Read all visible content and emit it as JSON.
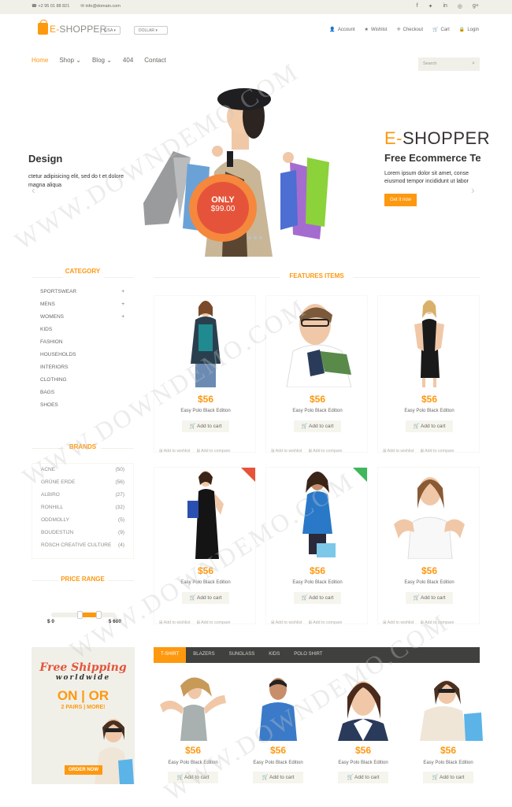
{
  "topbar": {
    "phone": "+2 95 01 88 821",
    "email": "info@domain.com",
    "social_icons": [
      "facebook-icon",
      "twitter-icon",
      "linkedin-icon",
      "dribbble-icon",
      "google-plus-icon"
    ]
  },
  "header": {
    "logo_e": "E-",
    "logo_rest": "SHOPPER",
    "country": "USA",
    "currency": "DOLLAR",
    "account_links": [
      {
        "label": "Account",
        "icon": "user-icon"
      },
      {
        "label": "Wishlist",
        "icon": "star-icon"
      },
      {
        "label": "Checkout",
        "icon": "crosshair-icon"
      },
      {
        "label": "Cart",
        "icon": "cart-icon"
      },
      {
        "label": "Login",
        "icon": "lock-icon"
      }
    ]
  },
  "nav": {
    "items": [
      "Home",
      "Shop",
      "Blog",
      "404",
      "Contact"
    ],
    "search_placeholder": "Search"
  },
  "slider": {
    "left_heading": "Design",
    "left_text": "ctetur adipisicing elit, sed do t et dolore magna aliqua",
    "right_brand_e": "E-",
    "right_brand_rest": "SHOPPER",
    "right_heading": "Free Ecommerce Te",
    "right_text_1": "Lorem ipsum dolor sit amet, conse",
    "right_text_2": "eiusmod tempor incididunt ut labor",
    "button": "Get it now",
    "badge_only": "ONLY",
    "badge_price": "$99.00"
  },
  "sidebar": {
    "category_title": "CATEGORY",
    "categories": [
      {
        "label": "SPORTSWEAR",
        "plus": "+"
      },
      {
        "label": "MENS",
        "plus": "+"
      },
      {
        "label": "WOMENS",
        "plus": "+"
      },
      {
        "label": "KIDS",
        "plus": ""
      },
      {
        "label": "FASHION",
        "plus": ""
      },
      {
        "label": "HOUSEHOLDS",
        "plus": ""
      },
      {
        "label": "INTERIORS",
        "plus": ""
      },
      {
        "label": "CLOTHING",
        "plus": ""
      },
      {
        "label": "BAGS",
        "plus": ""
      },
      {
        "label": "SHOES",
        "plus": ""
      }
    ],
    "brands_title": "BRANDS",
    "brands": [
      {
        "label": "ACNE",
        "count": "(50)"
      },
      {
        "label": "GRÜNE ERDE",
        "count": "(56)"
      },
      {
        "label": "ALBIRO",
        "count": "(27)"
      },
      {
        "label": "RONHILL",
        "count": "(32)"
      },
      {
        "label": "ODDMOLLY",
        "count": "(5)"
      },
      {
        "label": "BOUDESTIJN",
        "count": "(9)"
      },
      {
        "label": "RÖSCH CREATIVE CULTURE",
        "count": "(4)"
      }
    ],
    "price_title": "PRICE RANGE",
    "price_min": "$ 0",
    "price_max": "$ 600",
    "ad": {
      "line1": "Free Shipping",
      "line2": "worldwide",
      "line3": "ON | OR",
      "line4": "2 PAIRS | MORE!",
      "button": "ORDER NOW"
    }
  },
  "features": {
    "title": "FEATURES ITEMS",
    "items": [
      {
        "price": "$56",
        "name": "Easy Polo Black Edition",
        "cart": "Add to cart",
        "ribbon": ""
      },
      {
        "price": "$56",
        "name": "Easy Polo Black Edition",
        "cart": "Add to cart",
        "ribbon": ""
      },
      {
        "price": "$56",
        "name": "Easy Polo Black Edition",
        "cart": "Add to cart",
        "ribbon": ""
      },
      {
        "price": "$56",
        "name": "Easy Polo Black Edition",
        "cart": "Add to cart",
        "ribbon": "new"
      },
      {
        "price": "$56",
        "name": "Easy Polo Black Edition",
        "cart": "Add to cart",
        "ribbon": "sale"
      },
      {
        "price": "$56",
        "name": "Easy Polo Black Edition",
        "cart": "Add to cart",
        "ribbon": ""
      }
    ],
    "wishlist": "Add to wishlist",
    "compare": "Add to compare"
  },
  "tabs": {
    "items": [
      "T-SHIRT",
      "BLAZERS",
      "SUNGLASS",
      "KIDS",
      "POLO SHIRT"
    ],
    "products": [
      {
        "price": "$56",
        "name": "Easy Polo Black Edition",
        "cart": "Add to cart"
      },
      {
        "price": "$56",
        "name": "Easy Polo Black Edition",
        "cart": "Add to cart"
      },
      {
        "price": "$56",
        "name": "Easy Polo Black Edition",
        "cart": "Add to cart"
      },
      {
        "price": "$56",
        "name": "Easy Polo Black Edition",
        "cart": "Add to cart"
      }
    ]
  },
  "watermark": "WWW.DOWNDEMO.COM",
  "colors": {
    "accent": "#FE980F",
    "dark": "#363432",
    "bar": "#40403E",
    "light": "#F0F0E9"
  }
}
